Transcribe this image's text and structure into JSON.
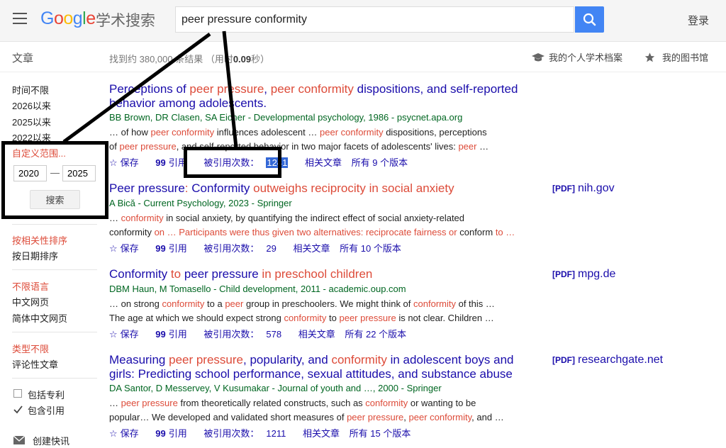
{
  "header": {
    "logo": "Google",
    "logo_sub": "学术搜索",
    "search_value": "peer pressure conformity",
    "login": "登录"
  },
  "subheader": {
    "articles": "文章",
    "stats_prefix": "找到约 380,000 条结果 （用时",
    "stats_time": "0.09",
    "stats_suffix": "秒）",
    "profile": "我的个人学术档案",
    "library": "我的图书馆"
  },
  "sidebar": {
    "time_any": "时间不限",
    "since_2026": "2026以来",
    "since_2025": "2025以来",
    "since_2022": "2022以来",
    "custom_range": "自定义范围...",
    "year_from": "2020",
    "dash": "—",
    "year_to": "2025",
    "search_button": "搜索",
    "sort_relevance": "按相关性排序",
    "sort_date": "按日期排序",
    "lang_any": "不限语言",
    "lang_chinese": "中文网页",
    "lang_simplified": "简体中文网页",
    "type_any": "类型不限",
    "type_review": "评论性文章",
    "include_patents": "包括专利",
    "include_citations": "包含引用",
    "create_alert": "创建快讯"
  },
  "results": [
    {
      "title_parts": [
        "Perceptions of ",
        "peer pressure",
        ", ",
        "peer conformity",
        " dispositions, and self-reported behavior among adolescents."
      ],
      "authors": "BB Brown, DR Clasen, SA Eicher - Developmental psychology, 1986 - psycnet.apa.org",
      "snippet1_parts": [
        "… of how ",
        "peer conformity",
        " influences adolescent … ",
        "peer conformity",
        " dispositions, perceptions"
      ],
      "snippet2_parts": [
        "of ",
        "peer pressure",
        ", and self-reported behavior in two major facets of adolescents' lives: ",
        "peer",
        " …"
      ],
      "save": "保存",
      "cite": "引用",
      "cited_label": "被引用次数：",
      "cited_count": "1241",
      "related": "相关文章",
      "versions": "所有 9 个版本",
      "pdf_tag": "",
      "pdf_source": ""
    },
    {
      "title_parts": [
        "Peer pressure",
        ": ",
        "Conformity",
        " outweighs reciprocity in social anxiety"
      ],
      "authors": "A Bică - Current Psychology, 2023 - Springer",
      "snippet1_parts": [
        "… ",
        "conformity",
        " in social anxiety, by quantifying the indirect effect of social anxiety-related"
      ],
      "snippet2_parts": [
        "conformity",
        " on … Participants were thus given two alternatives: reciprocate fairness or ",
        "conform",
        " to …"
      ],
      "save": "保存",
      "cite": "引用",
      "cited_label": "被引用次数：",
      "cited_count": "29",
      "related": "相关文章",
      "versions": "所有 10 个版本",
      "pdf_tag": "[PDF]",
      "pdf_source": "nih.gov"
    },
    {
      "title_parts": [
        "Conformity",
        " to ",
        "peer pressure",
        " in preschool children"
      ],
      "authors": "DBM Haun, M Tomasello - Child development, 2011 - academic.oup.com",
      "snippet1_parts": [
        "… on strong ",
        "conformity",
        " to a ",
        "peer",
        " group in preschoolers. We might think of ",
        "conformity",
        " of this …"
      ],
      "snippet2_parts": [
        "The age at which we should expect strong ",
        "conformity",
        " to ",
        "peer pressure",
        " is not clear. Children …"
      ],
      "save": "保存",
      "cite": "引用",
      "cited_label": "被引用次数：",
      "cited_count": "578",
      "related": "相关文章",
      "versions": "所有 22 个版本",
      "pdf_tag": "[PDF]",
      "pdf_source": "mpg.de"
    },
    {
      "title_parts": [
        "Measuring ",
        "peer pressure",
        ", popularity, and ",
        "conformity",
        " in adolescent boys and girls: Predicting school performance, sexual attitudes, and substance abuse"
      ],
      "authors": "DA Santor, D Messervey, V Kusumakar - Journal of youth and …, 2000 - Springer",
      "snippet1_parts": [
        "… ",
        "peer pressure",
        " from theoretically related constructs, such as ",
        "conformity",
        " or wanting to be"
      ],
      "snippet2_parts": [
        "popular… We developed and validated short measures of ",
        "peer pressure",
        ", ",
        "peer conformity",
        ", and …"
      ],
      "save": "保存",
      "cite": "引用",
      "cited_label": "被引用次数：",
      "cited_count": "1211",
      "related": "相关文章",
      "versions": "所有 15 个版本",
      "pdf_tag": "[PDF]",
      "pdf_source": "researchgate.net"
    }
  ],
  "colors": {
    "brand_blue": "#4285f4",
    "link": "#1a0dab",
    "highlight": "#dd4b39",
    "source_green": "#006621"
  }
}
